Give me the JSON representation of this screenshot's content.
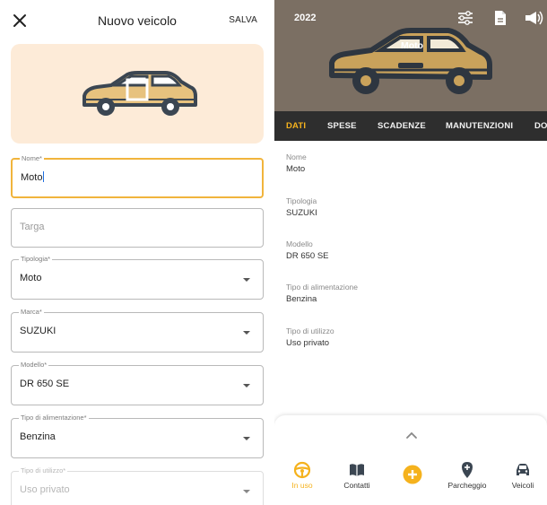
{
  "form": {
    "title": "Nuovo veicolo",
    "save_label": "SALVA",
    "fields": [
      {
        "label": "Nome*",
        "value": "Moto",
        "placeholder": ""
      },
      {
        "label": "",
        "value": "",
        "placeholder": "Targa"
      },
      {
        "label": "Tipologia*",
        "value": "Moto"
      },
      {
        "label": "Marca*",
        "value": "SUZUKI"
      },
      {
        "label": "Modello*",
        "value": "DR 650 SE"
      },
      {
        "label": "Tipo di alimentazione*",
        "value": "Benzina"
      },
      {
        "label": "Tipo di utilizzo*",
        "value": "Uso privato"
      }
    ],
    "hero_color": "#fdebd8",
    "focus_color": "#f1b43c"
  },
  "vehicle": {
    "year": "2022",
    "name": "Moto",
    "header_color": "#7b6f63",
    "icons": [
      "sliders-icon",
      "document-icon",
      "horn-icon"
    ],
    "tabs": [
      "DATI",
      "SPESE",
      "SCADENZE",
      "MANUTENZIONI",
      "DO"
    ],
    "active_tab": "DATI",
    "details": [
      {
        "label": "Nome",
        "value": "Moto"
      },
      {
        "label": "Tipologia",
        "value": "SUZUKI"
      },
      {
        "label": "Modello",
        "value": "DR 650 SE"
      },
      {
        "label": "Tipo di alimentazione",
        "value": "Benzina"
      },
      {
        "label": "Tipo di utilizzo",
        "value": "Uso privato"
      }
    ]
  },
  "bottom_nav": {
    "items": [
      {
        "label": "In uso",
        "icon": "steering-wheel-icon"
      },
      {
        "label": "Contatti",
        "icon": "book-icon"
      },
      {
        "label": "",
        "icon": "add-icon"
      },
      {
        "label": "Parcheggio",
        "icon": "location-pin-icon"
      },
      {
        "label": "Veicoli",
        "icon": "car-icon"
      }
    ],
    "accent": "#f5b21d"
  }
}
